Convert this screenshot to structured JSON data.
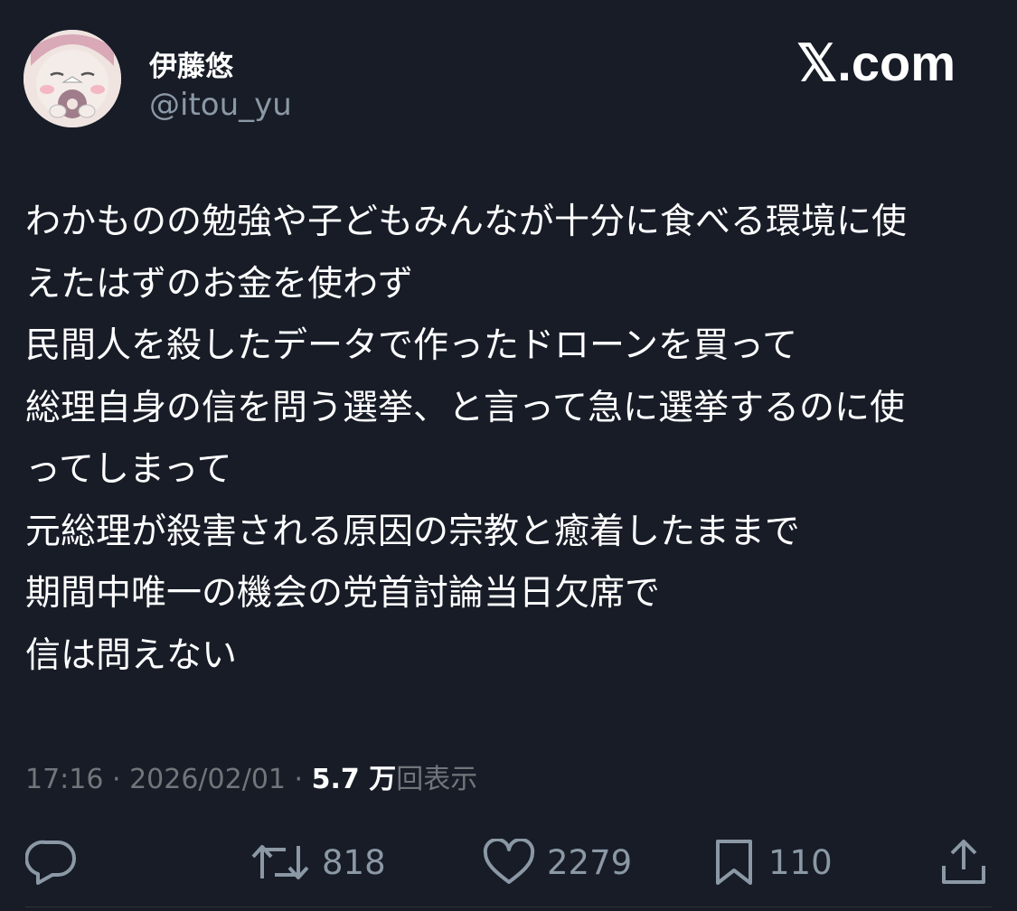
{
  "user": {
    "display_name": "伊藤悠",
    "handle": "@itou_yu",
    "avatar_icon": "cartoon-avatar-icon"
  },
  "site_mark": "𝕏.com",
  "tweet": {
    "lines": [
      "わかものの勉強や子どもみんなが十分に食べる環境に使",
      "えたはずのお金を使わず",
      "民間人を殺したデータで作ったドローンを買って",
      "総理自身の信を問う選挙、と言って急に選挙するのに使",
      "ってしまって",
      "元総理が殺害される原因の宗教と癒着したままで",
      "期間中唯一の機会の党首討論当日欠席で",
      "信は問えない"
    ]
  },
  "meta": {
    "time": "17:16",
    "separator": " · ",
    "date": "2026/02/01",
    "views_count": "5.7 万",
    "views_label": "回表示"
  },
  "actions": {
    "reply": {
      "icon": "reply-icon"
    },
    "retweet": {
      "icon": "retweet-icon",
      "count": "818"
    },
    "like": {
      "icon": "heart-icon",
      "count": "2279"
    },
    "bookmark": {
      "icon": "bookmark-icon",
      "count": "110"
    },
    "share": {
      "icon": "share-icon"
    }
  },
  "colors": {
    "background": "#171c27",
    "text": "#ffffff",
    "secondary": "#8b98a5",
    "muted": "#71767b"
  }
}
